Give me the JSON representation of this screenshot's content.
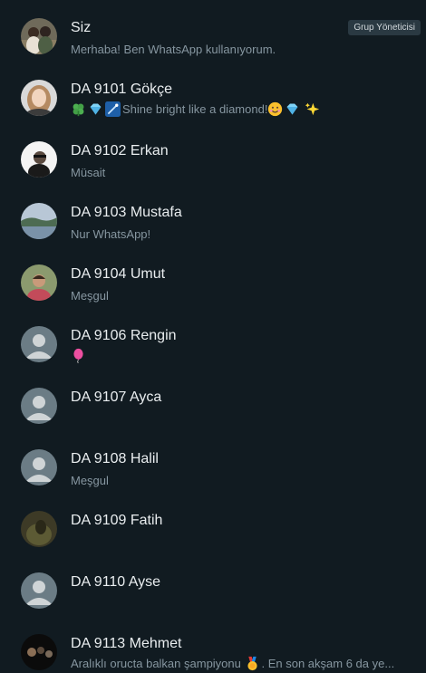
{
  "participants": [
    {
      "name": "Siz",
      "status": "Merhaba! Ben WhatsApp kullanıyorum.",
      "badge": "Grup Yöneticisi",
      "avatar": "photo-avatar"
    },
    {
      "name": "DA 9101 Gökçe",
      "status": "Shine bright like a diamond!",
      "avatar": "photo-avatar"
    },
    {
      "name": "DA 9102 Erkan",
      "status": "Müsait",
      "avatar": "photo-avatar"
    },
    {
      "name": "DA 9103 Mustafa",
      "status": "Nur WhatsApp!",
      "avatar": "photo-avatar"
    },
    {
      "name": "DA 9104 Umut",
      "status": "Meşgul",
      "avatar": "photo-avatar"
    },
    {
      "name": "DA 9106 Rengin",
      "status": "",
      "avatar": "default-user-icon"
    },
    {
      "name": "DA 9107 Ayca",
      "status": "",
      "avatar": "default-user-icon"
    },
    {
      "name": "DA 9108 Halil",
      "status": "Meşgul",
      "avatar": "default-user-icon"
    },
    {
      "name": "DA 9109 Fatih",
      "status": "",
      "avatar": "photo-avatar"
    },
    {
      "name": "DA 9110 Ayse",
      "status": "",
      "avatar": "default-user-icon"
    },
    {
      "name": "DA 9113 Mehmet",
      "status_before": "Aralıklı oructa balkan şampiyonu",
      "status_after": ". En son akşam 6 da ye...",
      "avatar": "photo-avatar"
    }
  ],
  "emoji": {
    "gokce": [
      "clover-icon",
      "diamond-icon",
      "shooting-star-icon",
      "smiling-face-icon",
      "diamond-icon",
      "sparkles-icon"
    ],
    "rengin": [
      "balloon-icon"
    ],
    "mehmet": [
      "medal-icon"
    ]
  },
  "colors": {
    "background": "#111b21",
    "name": "#e9edef",
    "status": "#8696a0",
    "badge_bg": "#2a3942",
    "default_avatar": "#6b7c85"
  }
}
